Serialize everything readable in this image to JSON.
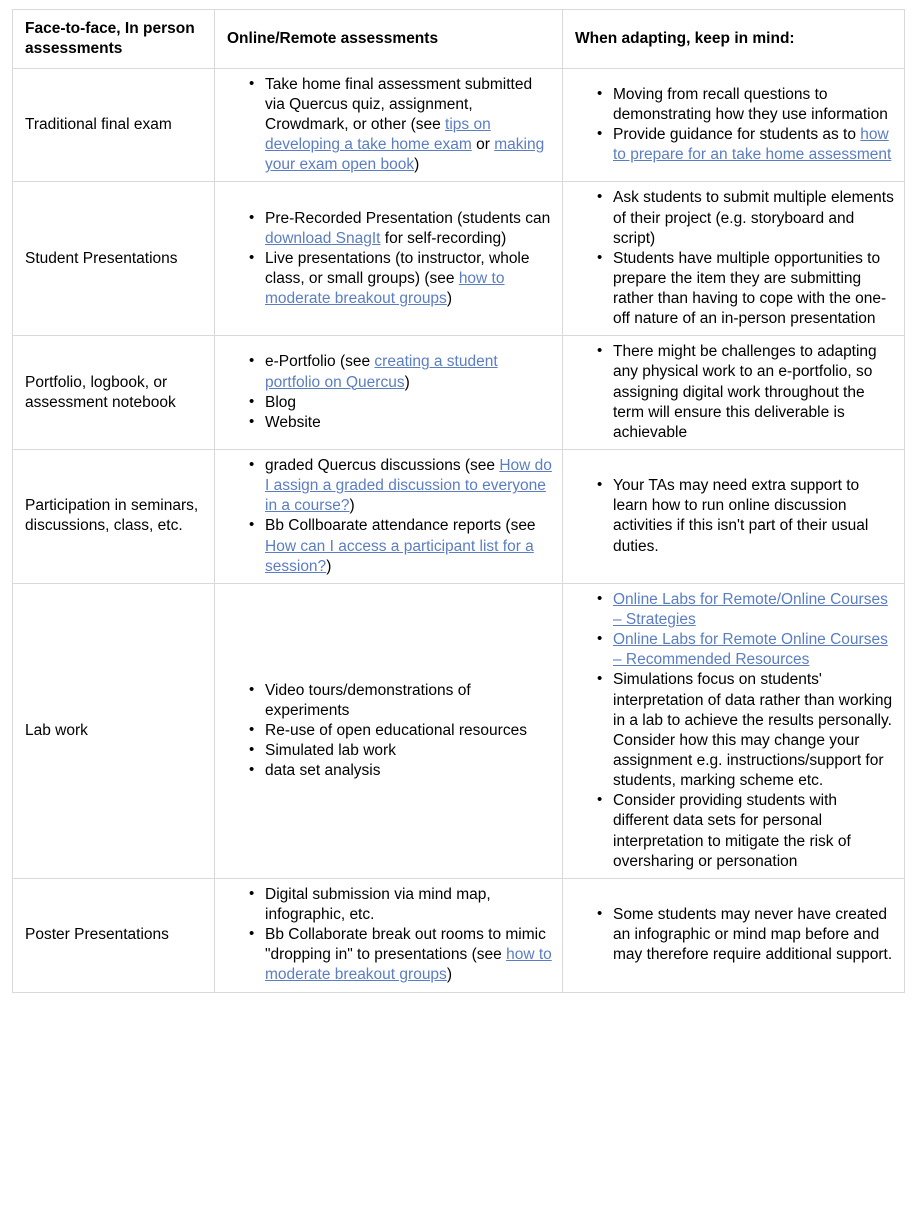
{
  "table": {
    "headers": [
      "Face-to-face, In person assessments",
      "Online/Remote assessments",
      "When adapting, keep in mind:"
    ],
    "rows": [
      {
        "label": "Traditional final exam",
        "online": [
          {
            "parts": [
              {
                "t": "Take home final assessment submitted via Quercus quiz, assignment, Crowdmark, or other (see "
              },
              {
                "t": "tips on developing a take home exam",
                "link": true
              },
              {
                "t": " or "
              },
              {
                "t": "making your exam open book",
                "link": true
              },
              {
                "t": ")"
              }
            ]
          }
        ],
        "keep_in_mind": [
          {
            "parts": [
              {
                "t": "Moving from recall questions to demonstrating how they use information"
              }
            ]
          },
          {
            "parts": [
              {
                "t": "Provide guidance for students as to "
              },
              {
                "t": "how to prepare for an take home assessment",
                "link": true
              }
            ]
          }
        ]
      },
      {
        "label": "Student Presentations",
        "online": [
          {
            "parts": [
              {
                "t": "Pre-Recorded Presentation (students can "
              },
              {
                "t": "download SnagIt",
                "link": true
              },
              {
                "t": " for self-recording)"
              }
            ]
          },
          {
            "parts": [
              {
                "t": "Live presentations (to instructor, whole class, or small groups) (see "
              },
              {
                "t": "how to moderate breakout groups",
                "link": true
              },
              {
                "t": ")"
              }
            ]
          }
        ],
        "keep_in_mind": [
          {
            "parts": [
              {
                "t": "Ask students to submit multiple elements of their project (e.g. storyboard and script)"
              }
            ]
          },
          {
            "parts": [
              {
                "t": "Students have multiple opportunities to prepare the item they are submitting rather than having to cope with the one-off nature of an in-person presentation"
              }
            ]
          }
        ]
      },
      {
        "label": "Portfolio, logbook, or assessment notebook",
        "online": [
          {
            "parts": [
              {
                "t": "e-Portfolio (see "
              },
              {
                "t": "creating a student portfolio on Quercus",
                "link": true
              },
              {
                "t": ")"
              }
            ]
          },
          {
            "parts": [
              {
                "t": "Blog"
              }
            ]
          },
          {
            "parts": [
              {
                "t": "Website"
              }
            ]
          }
        ],
        "keep_in_mind": [
          {
            "parts": [
              {
                "t": "There might be challenges to adapting any physical work to an e-portfolio, so assigning digital work throughout the term will ensure this deliverable is achievable"
              }
            ]
          }
        ]
      },
      {
        "label": "Participation in seminars, discussions, class, etc.",
        "online": [
          {
            "parts": [
              {
                "t": "graded Quercus discussions (see "
              },
              {
                "t": "How do I assign a graded discussion to everyone in a course?",
                "link": true
              },
              {
                "t": ")"
              }
            ]
          },
          {
            "parts": [
              {
                "t": "Bb Collboarate attendance reports (see "
              },
              {
                "t": "How can I access a participant list for a session?",
                "link": true
              },
              {
                "t": ")"
              }
            ]
          }
        ],
        "keep_in_mind": [
          {
            "parts": [
              {
                "t": "Your TAs may need extra support to learn how to run online discussion activities if this isn't part of their usual duties."
              }
            ]
          }
        ]
      },
      {
        "label": "Lab work",
        "online": [
          {
            "parts": [
              {
                "t": "Video tours/demonstrations of experiments"
              }
            ]
          },
          {
            "parts": [
              {
                "t": "Re-use of open educational resources"
              }
            ]
          },
          {
            "parts": [
              {
                "t": "Simulated lab work"
              }
            ]
          },
          {
            "parts": [
              {
                "t": "data set analysis"
              }
            ]
          }
        ],
        "keep_in_mind": [
          {
            "parts": [
              {
                "t": "Online Labs for Remote/Online Courses – Strategies",
                "link": true
              }
            ]
          },
          {
            "parts": [
              {
                "t": "Online Labs for Remote Online Courses – Recommended Resources",
                "link": true
              }
            ]
          },
          {
            "parts": [
              {
                "t": "Simulations focus on students' interpretation of data rather than working in a lab to achieve the results personally. Consider how this may change your assignment e.g. instructions/support for students, marking scheme etc."
              }
            ]
          },
          {
            "parts": [
              {
                "t": "Consider providing students with different data sets for personal interpretation to mitigate the risk of oversharing or personation"
              }
            ]
          }
        ]
      },
      {
        "label": "Poster Presentations",
        "online": [
          {
            "parts": [
              {
                "t": "Digital submission via mind map, infographic, etc."
              }
            ]
          },
          {
            "parts": [
              {
                "t": "Bb Collaborate break out rooms to mimic \"dropping in\" to presentations (see "
              },
              {
                "t": "how to moderate breakout groups",
                "link": true
              },
              {
                "t": ")"
              }
            ]
          }
        ],
        "keep_in_mind": [
          {
            "parts": [
              {
                "t": "Some students may never have created an infographic or mind map before and may therefore require additional support."
              }
            ]
          }
        ]
      }
    ]
  },
  "colors": {
    "link": "#5b7ec2",
    "border": "#d9d9d9",
    "text": "#000000",
    "background": "#ffffff"
  }
}
